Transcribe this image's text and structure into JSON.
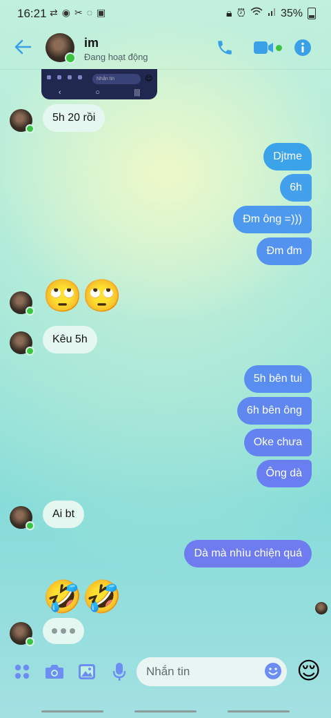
{
  "status_bar": {
    "time": "16:21",
    "battery": "35%"
  },
  "header": {
    "contact_name": "im",
    "contact_status": "Đang hoạt động"
  },
  "preview": {
    "input_placeholder": "Nhắn tin"
  },
  "messages": [
    {
      "text": "5h 20 rồi"
    },
    {
      "text": "Djtme"
    },
    {
      "text": "6h"
    },
    {
      "text": "Đm ông =)))"
    },
    {
      "text": "Đm đm"
    },
    {
      "text": "🙄🙄"
    },
    {
      "text": "Kêu 5h"
    },
    {
      "text": "5h bên tui"
    },
    {
      "text": "6h bên ông"
    },
    {
      "text": "Oke chưa"
    },
    {
      "text": "Ông dà"
    },
    {
      "text": "Ai bt"
    },
    {
      "text": "Dà mà nhìu chiện quá"
    },
    {
      "text": "🤣🤣"
    }
  ],
  "composer": {
    "placeholder": "Nhắn tin",
    "quick_emoji": "😌"
  },
  "colors": {
    "accent": "#3aa0e8",
    "outgoing_top": "#3aa0e8",
    "outgoing_bottom": "#6f7cf0",
    "online": "#3ac43f"
  }
}
